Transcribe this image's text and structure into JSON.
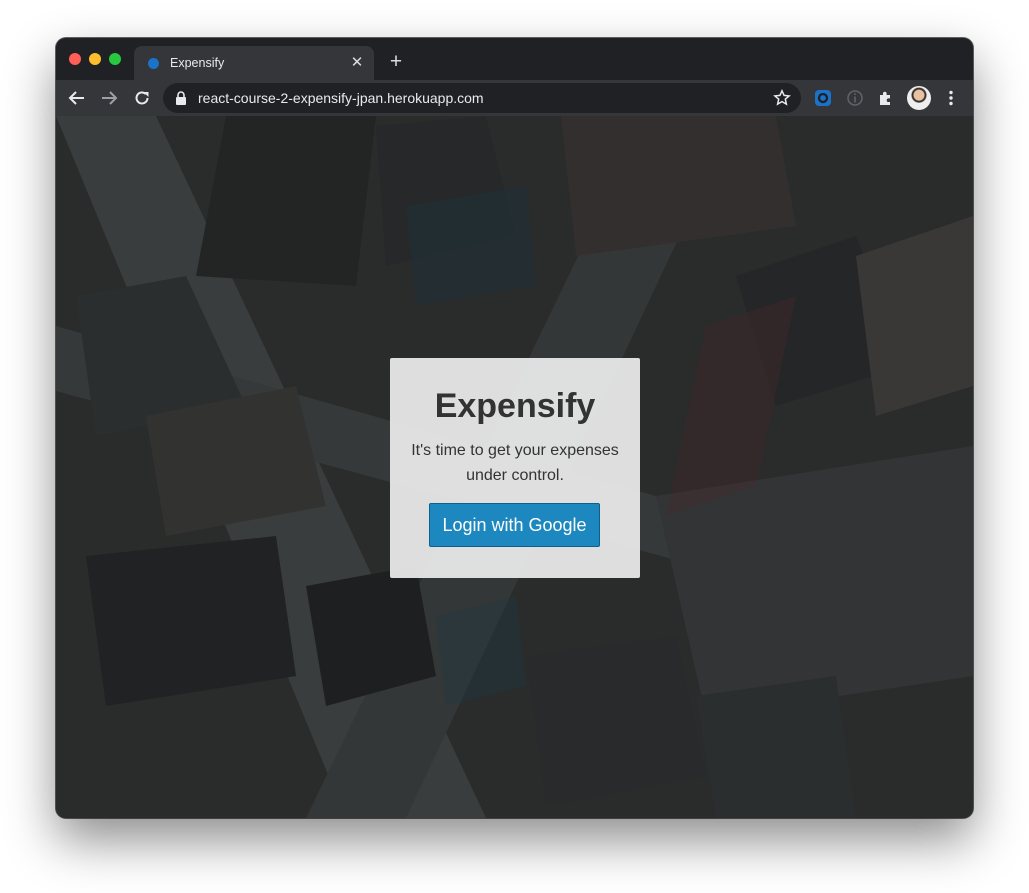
{
  "browser": {
    "tab_title": "Expensify",
    "url": "react-course-2-expensify-jpan.herokuapp.com",
    "favicon_color": "#1a73c8",
    "icons": [
      "back-icon",
      "forward-icon",
      "reload-icon",
      "lock-icon",
      "star-icon",
      "extension-icon",
      "info-icon",
      "puzzle-icon",
      "avatar",
      "kebab-menu-icon"
    ]
  },
  "page": {
    "title": "Expensify",
    "subtitle": "It's time to get your expenses under control.",
    "login_button": "Login with Google",
    "button_color": "#1c88bf"
  }
}
